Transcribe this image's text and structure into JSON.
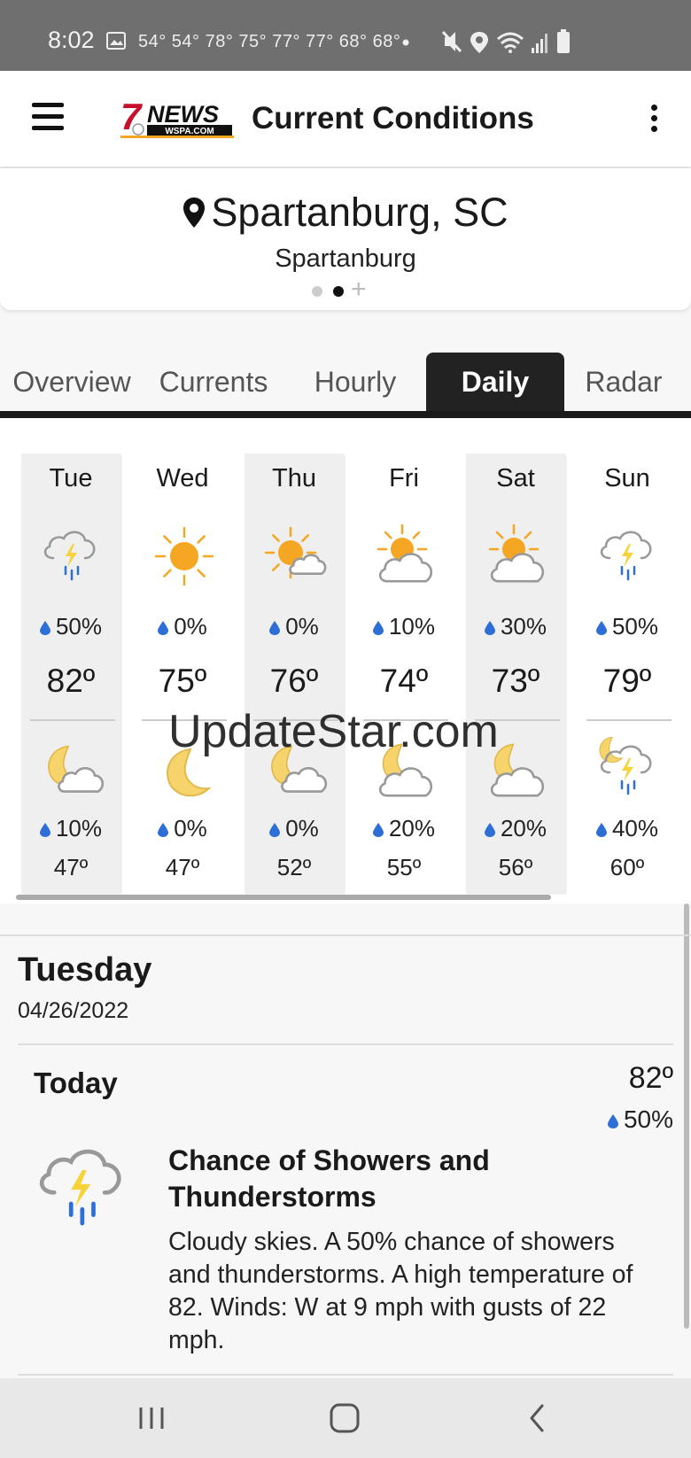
{
  "status_bar": {
    "time": "8:02",
    "notification_temps": "54° 54° 78° 75° 77° 77° 68° 68°",
    "icons": [
      "image-icon",
      "mute-icon",
      "location-icon",
      "wifi-icon",
      "signal-icon",
      "battery-icon"
    ]
  },
  "app_bar": {
    "logo_number": "7",
    "logo_word": "NEWS",
    "logo_site": "WSPA.COM",
    "title": "Current Conditions"
  },
  "location": {
    "name": "Spartanburg, SC",
    "subtitle": "Spartanburg",
    "add_symbol": "+"
  },
  "tabs": [
    {
      "label": "Overview",
      "active": false
    },
    {
      "label": "Currents",
      "active": false
    },
    {
      "label": "Hourly",
      "active": false
    },
    {
      "label": "Daily",
      "active": true
    },
    {
      "label": "Radar",
      "active": false
    }
  ],
  "days": [
    {
      "name": "Tue",
      "day_icon": "thunderstorm-icon",
      "day_pop": "50%",
      "high": "82º",
      "night_icon": "partly-cloudy-night-icon",
      "night_pop": "10%",
      "low": "47º"
    },
    {
      "name": "Wed",
      "day_icon": "sunny-icon",
      "day_pop": "0%",
      "high": "75º",
      "night_icon": "clear-night-icon",
      "night_pop": "0%",
      "low": "47º"
    },
    {
      "name": "Thu",
      "day_icon": "partly-sunny-icon",
      "day_pop": "0%",
      "high": "76º",
      "night_icon": "partly-cloudy-night-icon",
      "night_pop": "0%",
      "low": "52º"
    },
    {
      "name": "Fri",
      "day_icon": "mostly-cloudy-day-icon",
      "day_pop": "10%",
      "high": "74º",
      "night_icon": "mostly-cloudy-night-icon",
      "night_pop": "20%",
      "low": "55º"
    },
    {
      "name": "Sat",
      "day_icon": "mostly-cloudy-day-icon",
      "day_pop": "30%",
      "high": "73º",
      "night_icon": "mostly-cloudy-night-icon",
      "night_pop": "20%",
      "low": "56º"
    },
    {
      "name": "Sun",
      "day_icon": "thunderstorm-icon",
      "day_pop": "50%",
      "high": "79º",
      "night_icon": "night-thunderstorm-icon",
      "night_pop": "40%",
      "low": "60º"
    }
  ],
  "watermark": "UpdateStar.com",
  "detail": {
    "day": "Tuesday",
    "date": "04/26/2022",
    "period": "Today",
    "high": "82º",
    "pop": "50%",
    "icon": "thunderstorm-icon",
    "title": "Chance of Showers and Thunderstorms",
    "text": "Cloudy skies.  A 50% chance of showers and thunderstorms.  A high temperature of 82.  Winds: W at 9 mph with gusts of 22 mph."
  },
  "colors": {
    "status_bar": "#6f6f6f",
    "active_tab": "#222222",
    "sun": "#f5a623",
    "moon": "#f7d46b",
    "rain": "#2d6fd6",
    "bolt": "#f7d33a",
    "logo_red": "#c8102e"
  }
}
